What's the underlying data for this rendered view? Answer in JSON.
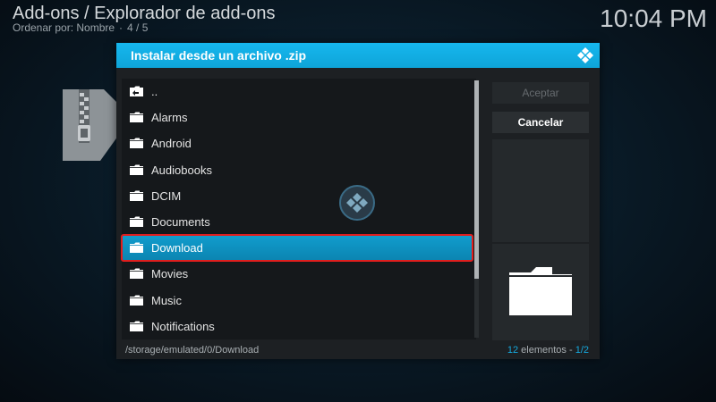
{
  "header": {
    "title": "Add-ons / Explorador de add-ons",
    "sort_label": "Ordenar por: Nombre",
    "page": "4 / 5",
    "clock": "10:04 PM"
  },
  "dialog": {
    "title": "Instalar desde un archivo .zip",
    "items": [
      {
        "label": ".."
      },
      {
        "label": "Alarms"
      },
      {
        "label": "Android"
      },
      {
        "label": "Audiobooks"
      },
      {
        "label": "DCIM"
      },
      {
        "label": "Documents"
      },
      {
        "label": "Download",
        "selected": true
      },
      {
        "label": "Movies"
      },
      {
        "label": "Music"
      },
      {
        "label": "Notifications"
      }
    ],
    "accept_label": "Aceptar",
    "cancel_label": "Cancelar",
    "path": "/storage/emulated/0/Download",
    "count_number": "12",
    "count_label": " elementos - ",
    "count_page": "1/2"
  },
  "colors": {
    "accent": "#12b2e7",
    "selection_outline": "#e01e1e"
  }
}
